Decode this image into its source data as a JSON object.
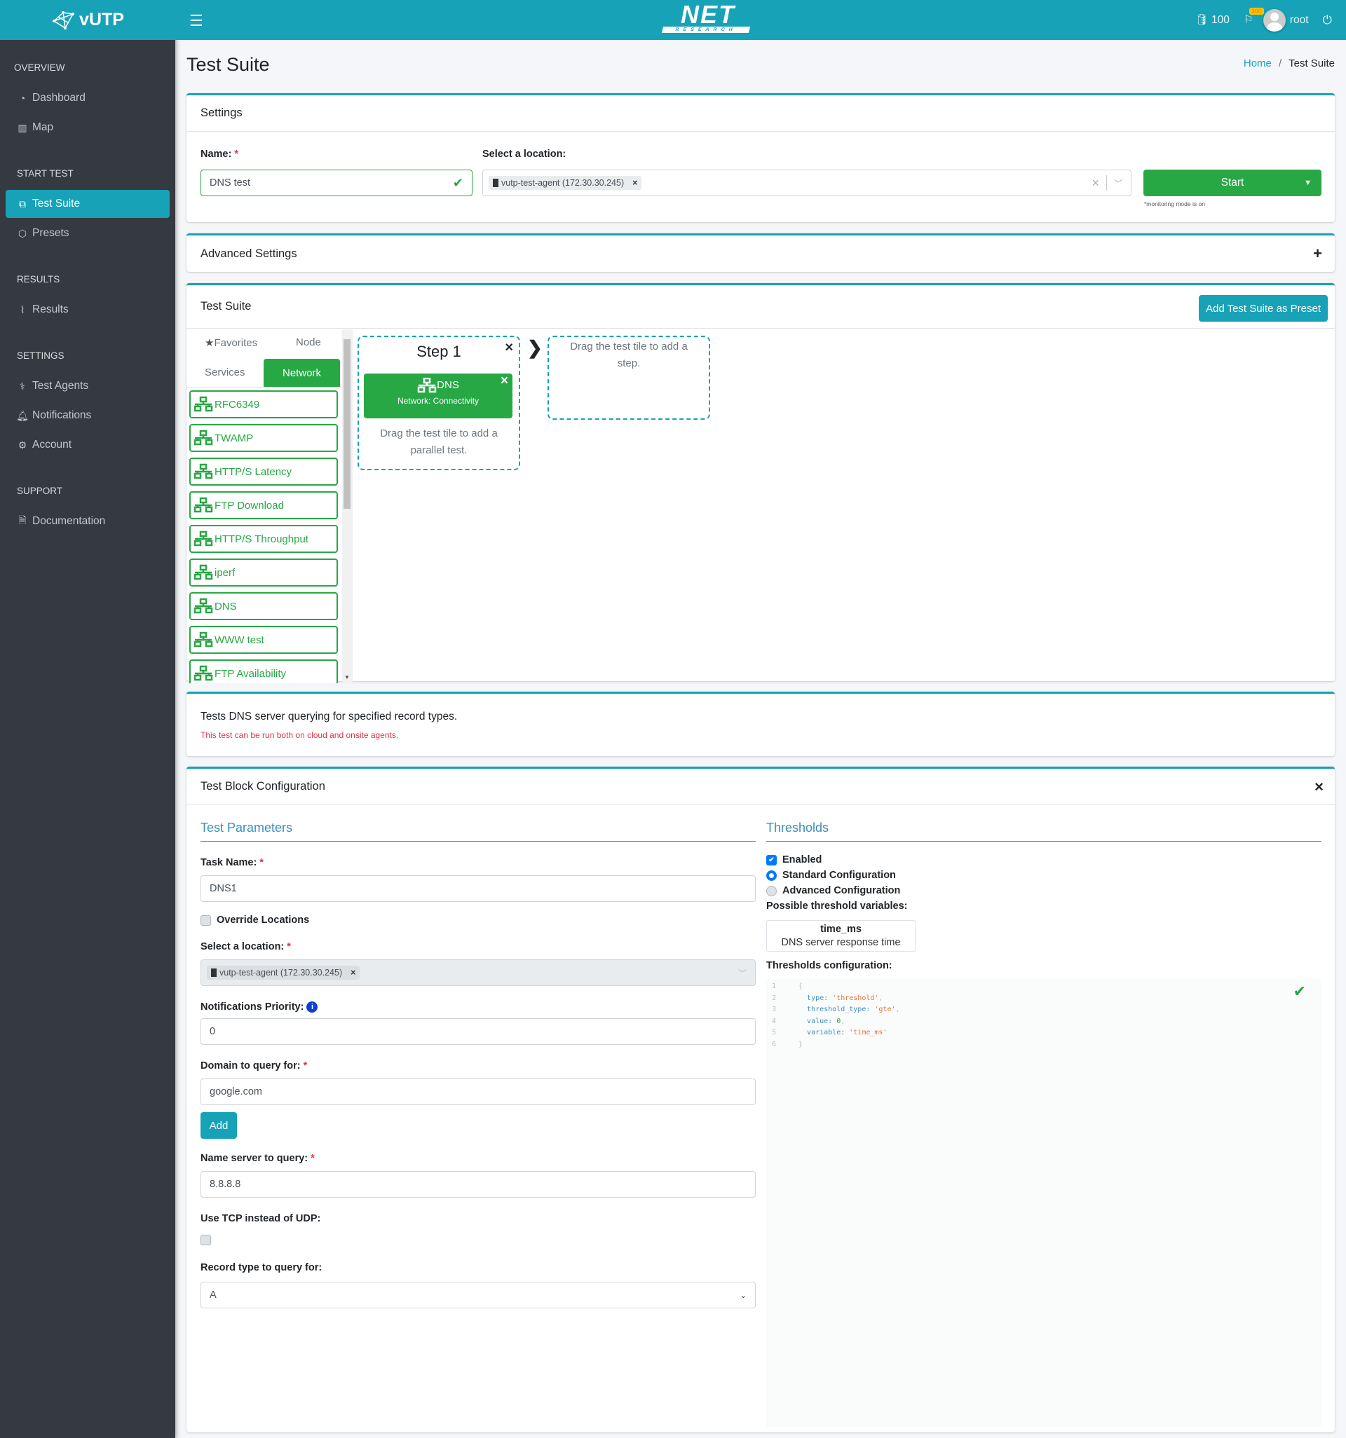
{
  "app": {
    "name": "vUTP",
    "logo_text": "NET",
    "logo_subtext": "RESEARCH"
  },
  "topbar": {
    "credits": "100",
    "flag_badge": "300",
    "user": "root",
    "icons": [
      "menu-icon",
      "database-icon",
      "flag-icon",
      "avatar",
      "power-icon"
    ]
  },
  "sidebar": {
    "sections": [
      {
        "title": "OVERVIEW",
        "items": [
          {
            "label": "Dashboard",
            "icon": "tachometer-icon"
          },
          {
            "label": "Map",
            "icon": "map-icon"
          }
        ]
      },
      {
        "title": "START TEST",
        "items": [
          {
            "label": "Test Suite",
            "icon": "cubes-icon",
            "active": true
          },
          {
            "label": "Presets",
            "icon": "cube-icon"
          }
        ]
      },
      {
        "title": "RESULTS",
        "items": [
          {
            "label": "Results",
            "icon": "chart-line-icon"
          }
        ]
      },
      {
        "title": "SETTINGS",
        "items": [
          {
            "label": "Test Agents",
            "icon": "stethoscope-icon"
          },
          {
            "label": "Notifications",
            "icon": "bell-icon"
          },
          {
            "label": "Account",
            "icon": "gear-icon"
          }
        ]
      },
      {
        "title": "SUPPORT",
        "items": [
          {
            "label": "Documentation",
            "icon": "file-icon"
          }
        ]
      }
    ]
  },
  "page": {
    "title": "Test Suite",
    "breadcrumb": {
      "home": "Home",
      "sep": "/",
      "current": "Test Suite"
    }
  },
  "settings": {
    "title": "Settings",
    "name_label": "Name:",
    "name_value": "DNS test",
    "location_label": "Select a location:",
    "location_chip": "vutp-test-agent (172.30.30.245)",
    "start_label": "Start",
    "monitoring_note": "*monitoring mode is on"
  },
  "advanced": {
    "title": "Advanced Settings",
    "toggle": "+"
  },
  "suite": {
    "title": "Test Suite",
    "preset_button": "Add Test Suite as Preset",
    "tabs": [
      "Favorites",
      "Node",
      "Services",
      "Network"
    ],
    "active_tab": "Network",
    "tiles": [
      "RFC6349",
      "TWAMP",
      "HTTP/S Latency",
      "FTP Download",
      "HTTP/S Throughput",
      "iperf",
      "DNS",
      "WWW test",
      "FTP Availability"
    ],
    "step": {
      "title": "Step 1",
      "test_name": "DNS",
      "test_category": "Network: Connectivity",
      "parallel_hint": "Drag the test tile to add a parallel test."
    },
    "new_step_hint": "Drag the test tile to add a step."
  },
  "description": {
    "text": "Tests DNS server querying for specified record types.",
    "note": "This test can be run both on cloud and onsite agents."
  },
  "config": {
    "title": "Test Block Configuration",
    "params": {
      "heading": "Test Parameters",
      "task_name_label": "Task Name:",
      "task_name_value": "DNS1",
      "override_label": "Override Locations",
      "override_checked": false,
      "location_label": "Select a location:",
      "location_chip": "vutp-test-agent (172.30.30.245)",
      "priority_label": "Notifications Priority:",
      "priority_value": "0",
      "domain_label": "Domain to query for:",
      "domain_value": "google.com",
      "add_label": "Add",
      "nameserver_label": "Name server to query:",
      "nameserver_value": "8.8.8.8",
      "tcp_label": "Use TCP instead of UDP:",
      "tcp_checked": false,
      "record_label": "Record type to query for:",
      "record_value": "A"
    },
    "thresholds": {
      "heading": "Thresholds",
      "enabled_label": "Enabled",
      "enabled": true,
      "standard_label": "Standard Configuration",
      "advanced_label": "Advanced Configuration",
      "mode": "standard",
      "vars_label": "Possible threshold variables:",
      "var_name": "time_ms",
      "var_desc": "DNS server response time",
      "config_label": "Thresholds configuration:",
      "code": {
        "l1": "{",
        "type_key": "type:",
        "type_val": "'threshold'",
        "tt_key": "threshold_type:",
        "tt_val": "'gte'",
        "val_key": "value:",
        "val_val": "0",
        "var_key": "variable:",
        "var_val": "'time_ms'",
        "l6": "}"
      }
    }
  },
  "colors": {
    "accent": "#17a2b8",
    "success": "#28a745",
    "sidebar": "#343a40",
    "danger": "#dc3545"
  }
}
